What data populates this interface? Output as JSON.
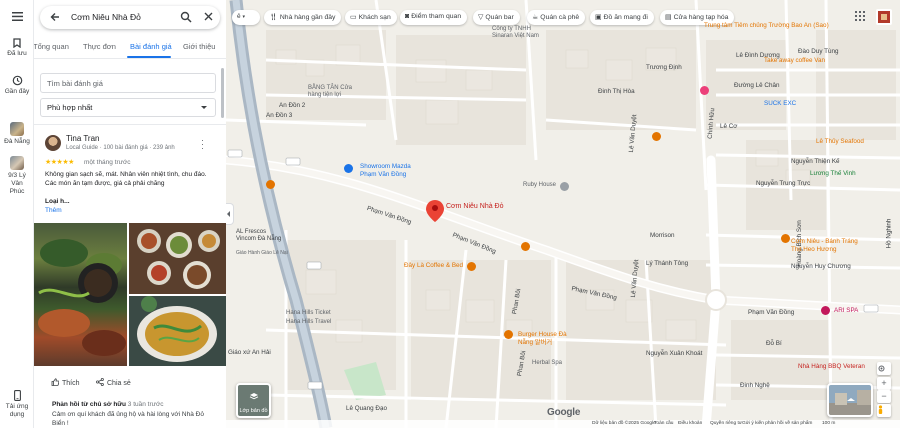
{
  "rail": {
    "items": [
      {
        "label": "Đã lưu",
        "icon": "bookmark-icon"
      },
      {
        "label": "Gần đây",
        "icon": "history-icon"
      },
      {
        "label": "Đà Nẵng",
        "icon": "place-thumbnail"
      },
      {
        "label": "9/3 Lý Vân Phúc",
        "icon": "place-thumbnail"
      },
      {
        "label": "Tải ứng dụng",
        "icon": "phone-icon"
      }
    ]
  },
  "search": {
    "query": "Cơm Niêu Nhà Đỏ"
  },
  "tabs": [
    {
      "label": "Tổng quan"
    },
    {
      "label": "Thực đơn"
    },
    {
      "label": "Bài đánh giá",
      "active": true
    },
    {
      "label": "Giới thiệu"
    }
  ],
  "reviews": {
    "search_placeholder": "Tìm bài đánh giá",
    "sort_selected": "Phù hợp nhất",
    "item": {
      "author": "Tina Tran",
      "meta": "Local Guide · 100 bài đánh giá · 239 ảnh",
      "stars": "★★★★★",
      "rating": 5,
      "time": "một tháng trước",
      "text": "Không gian sạch sẽ, mát. Nhân viên nhiệt tình, chu đáo. Các món ăn tạm được, giá cả phải chăng",
      "more_heading": "Loại h...",
      "more_link": "Thêm",
      "like_label": "Thích",
      "share_label": "Chia sẻ",
      "owner_reply_label": "Phản hồi từ chủ sở hữu",
      "owner_reply_time": "3 tuần trước",
      "owner_reply_text": "Cảm ơn quí khách đã ủng hộ và hài lòng với Nhà Đỏ Biển !"
    }
  },
  "map": {
    "chips": [
      {
        "label": "Nhà hàng gần đây",
        "icon": "restaurant-icon"
      },
      {
        "label": "Khách sạn",
        "icon": "hotel-icon"
      },
      {
        "label": "Điểm tham quan",
        "icon": "camera-icon"
      },
      {
        "label": "Quán bar",
        "icon": "bar-icon"
      },
      {
        "label": "Quán cà phê",
        "icon": "cafe-icon"
      },
      {
        "label": "Đồ ăn mang đi",
        "icon": "takeout-icon"
      },
      {
        "label": "Cửa hàng tạp hóa",
        "icon": "grocery-icon"
      }
    ],
    "first_chip": "ê",
    "pin_label": "Cơm Niêu Nhà Đỏ",
    "streets": [
      "Phạm Văn Đồng",
      "Phạm Văn Đồng",
      "Phạm Văn Đồng",
      "Phạm Văn Đồng",
      "Phan Bôi",
      "Phan Bôi",
      "Lê Văn Duyệt",
      "Lê Văn Duyệt",
      "Hồ Nghinh",
      "Nguyễn Thiện Kế",
      "Morrison",
      "Lý Thánh Tông",
      "Nguyễn Huy Chương",
      "Nguyễn Xuân Khoát",
      "Đinh Nghệ",
      "Đỗ Bí",
      "Đào Duy Tùng",
      "Lê Cơ",
      "Lê Đình Dương",
      "Đường Lê Chân",
      "Trương Định",
      "Đinh Thị Hòa",
      "An Đồn 2",
      "An Đồn 3",
      "Giáo xứ An Hải",
      "Lê Quang Đạo",
      "Nguyễn Trung Trực",
      "Hoàng Bích Sơn",
      "Chính Hữu"
    ],
    "pois": [
      {
        "label": "Công ty TNHH Sinaran Việt Nam",
        "color": "#5f6368"
      },
      {
        "label": "BẰNG TÂN Cửa hàng tiện lợi",
        "color": "#5f6368"
      },
      {
        "label": "Showroom Mazda Phạm Văn Đồng",
        "color": "#1a73e8"
      },
      {
        "label": "Ruby House",
        "color": "#5f6368"
      },
      {
        "label": "Đây Là Coffee & Bed",
        "color": "#e37400"
      },
      {
        "label": "Burger House Đà Nẵng 알버거",
        "color": "#e37400"
      },
      {
        "label": "Herbal Spa",
        "color": "#5f6368"
      },
      {
        "label": "Hana Hills Ticket",
        "color": "#5f6368"
      },
      {
        "label": "Hana Hills Travel",
        "color": "#5f6368"
      },
      {
        "label": "AL Frescos Vincom Đà Nẵng",
        "color": "#5f6368"
      },
      {
        "label": "Giáo Hành Giáo Lê Nại",
        "color": "#5f6368"
      },
      {
        "label": "Take away coffee Van",
        "color": "#e37400"
      },
      {
        "label": "SUCK EXC",
        "color": "#1a73e8"
      },
      {
        "label": "Cơm Niêu - Bánh Tráng Thịt Heo Hương",
        "color": "#e37400"
      },
      {
        "label": "Trung tâm Tiêm chủng Trường Bao An (Sao)",
        "color": "#e37400"
      },
      {
        "label": "ARI SPA",
        "color": "#c2185b"
      },
      {
        "label": "Nhà Hàng BBQ Veteran",
        "color": "#c5221f"
      },
      {
        "label": "Lê Thủy Seafood",
        "color": "#e37400"
      },
      {
        "label": "Lương Thế Vinh",
        "color": "#188038"
      }
    ],
    "layers_label": "Lớp bản đồ",
    "google_logo": "Google",
    "footer": [
      "Dữ liệu bản đồ ©2025 Google",
      "Toàn cầu",
      "Điều khoản",
      "Quyền riêng tư",
      "Gửi ý kiến phản hồi về sản phẩm",
      "100 m"
    ]
  }
}
